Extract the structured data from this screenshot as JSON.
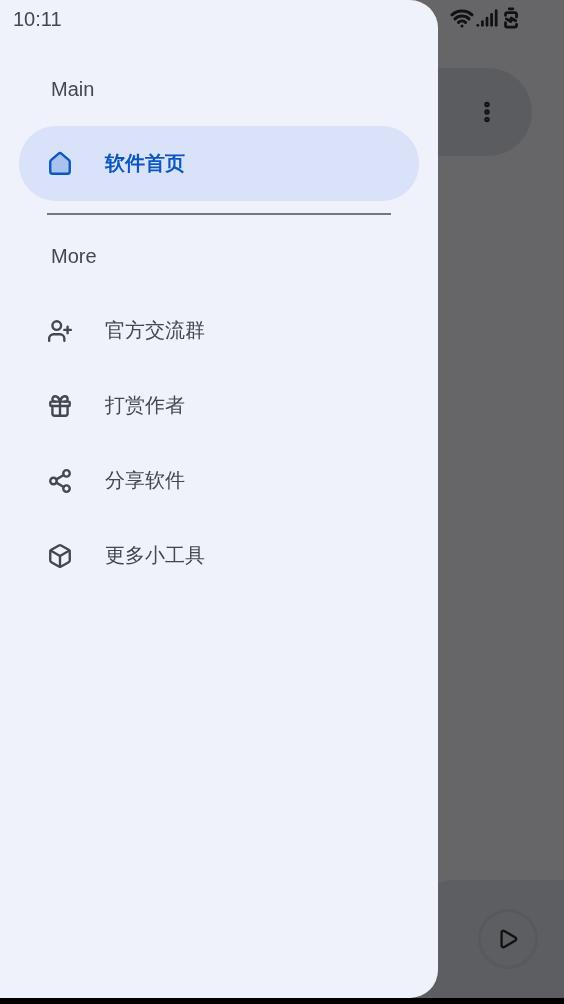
{
  "status_bar": {
    "time": "10:11"
  },
  "drawer": {
    "sections": [
      {
        "title": "Main",
        "items": [
          {
            "label": "软件首页",
            "selected": true
          }
        ]
      },
      {
        "title": "More",
        "items": [
          {
            "label": "官方交流群",
            "selected": false
          },
          {
            "label": "打赏作者",
            "selected": false
          },
          {
            "label": "分享软件",
            "selected": false
          },
          {
            "label": "更多小工具",
            "selected": false
          }
        ]
      }
    ]
  }
}
